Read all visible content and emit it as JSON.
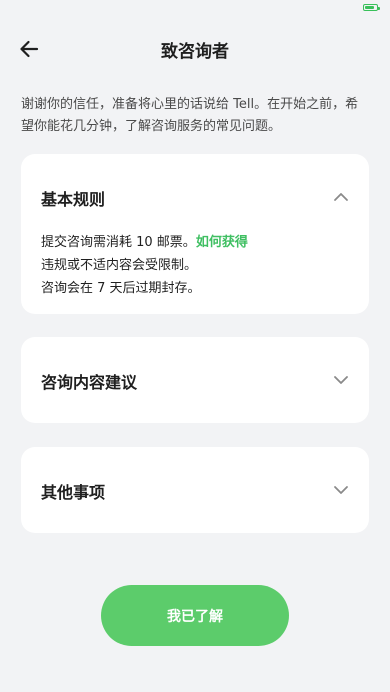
{
  "nav": {
    "title": "致咨询者",
    "back_icon": "arrow-left-icon"
  },
  "intro": "谢谢你的信任，准备将心里的话说给 Tell。在开始之前，希望你能花几分钟，了解咨询服务的常见问题。",
  "sections": [
    {
      "title": "基本规则",
      "expanded": true,
      "rules": [
        {
          "text": "提交咨询需消耗 10 邮票。",
          "link": "如何获得"
        },
        {
          "text": "违规或不适内容会受限制。"
        },
        {
          "text": "咨询会在 7 天后过期封存。"
        }
      ]
    },
    {
      "title": "咨询内容建议",
      "expanded": false
    },
    {
      "title": "其他事项",
      "expanded": false
    }
  ],
  "confirm_button": "我已了解",
  "colors": {
    "accent": "#5ccc6b",
    "link": "#3fbf62",
    "background": "#f2f3f5",
    "card": "#ffffff"
  }
}
